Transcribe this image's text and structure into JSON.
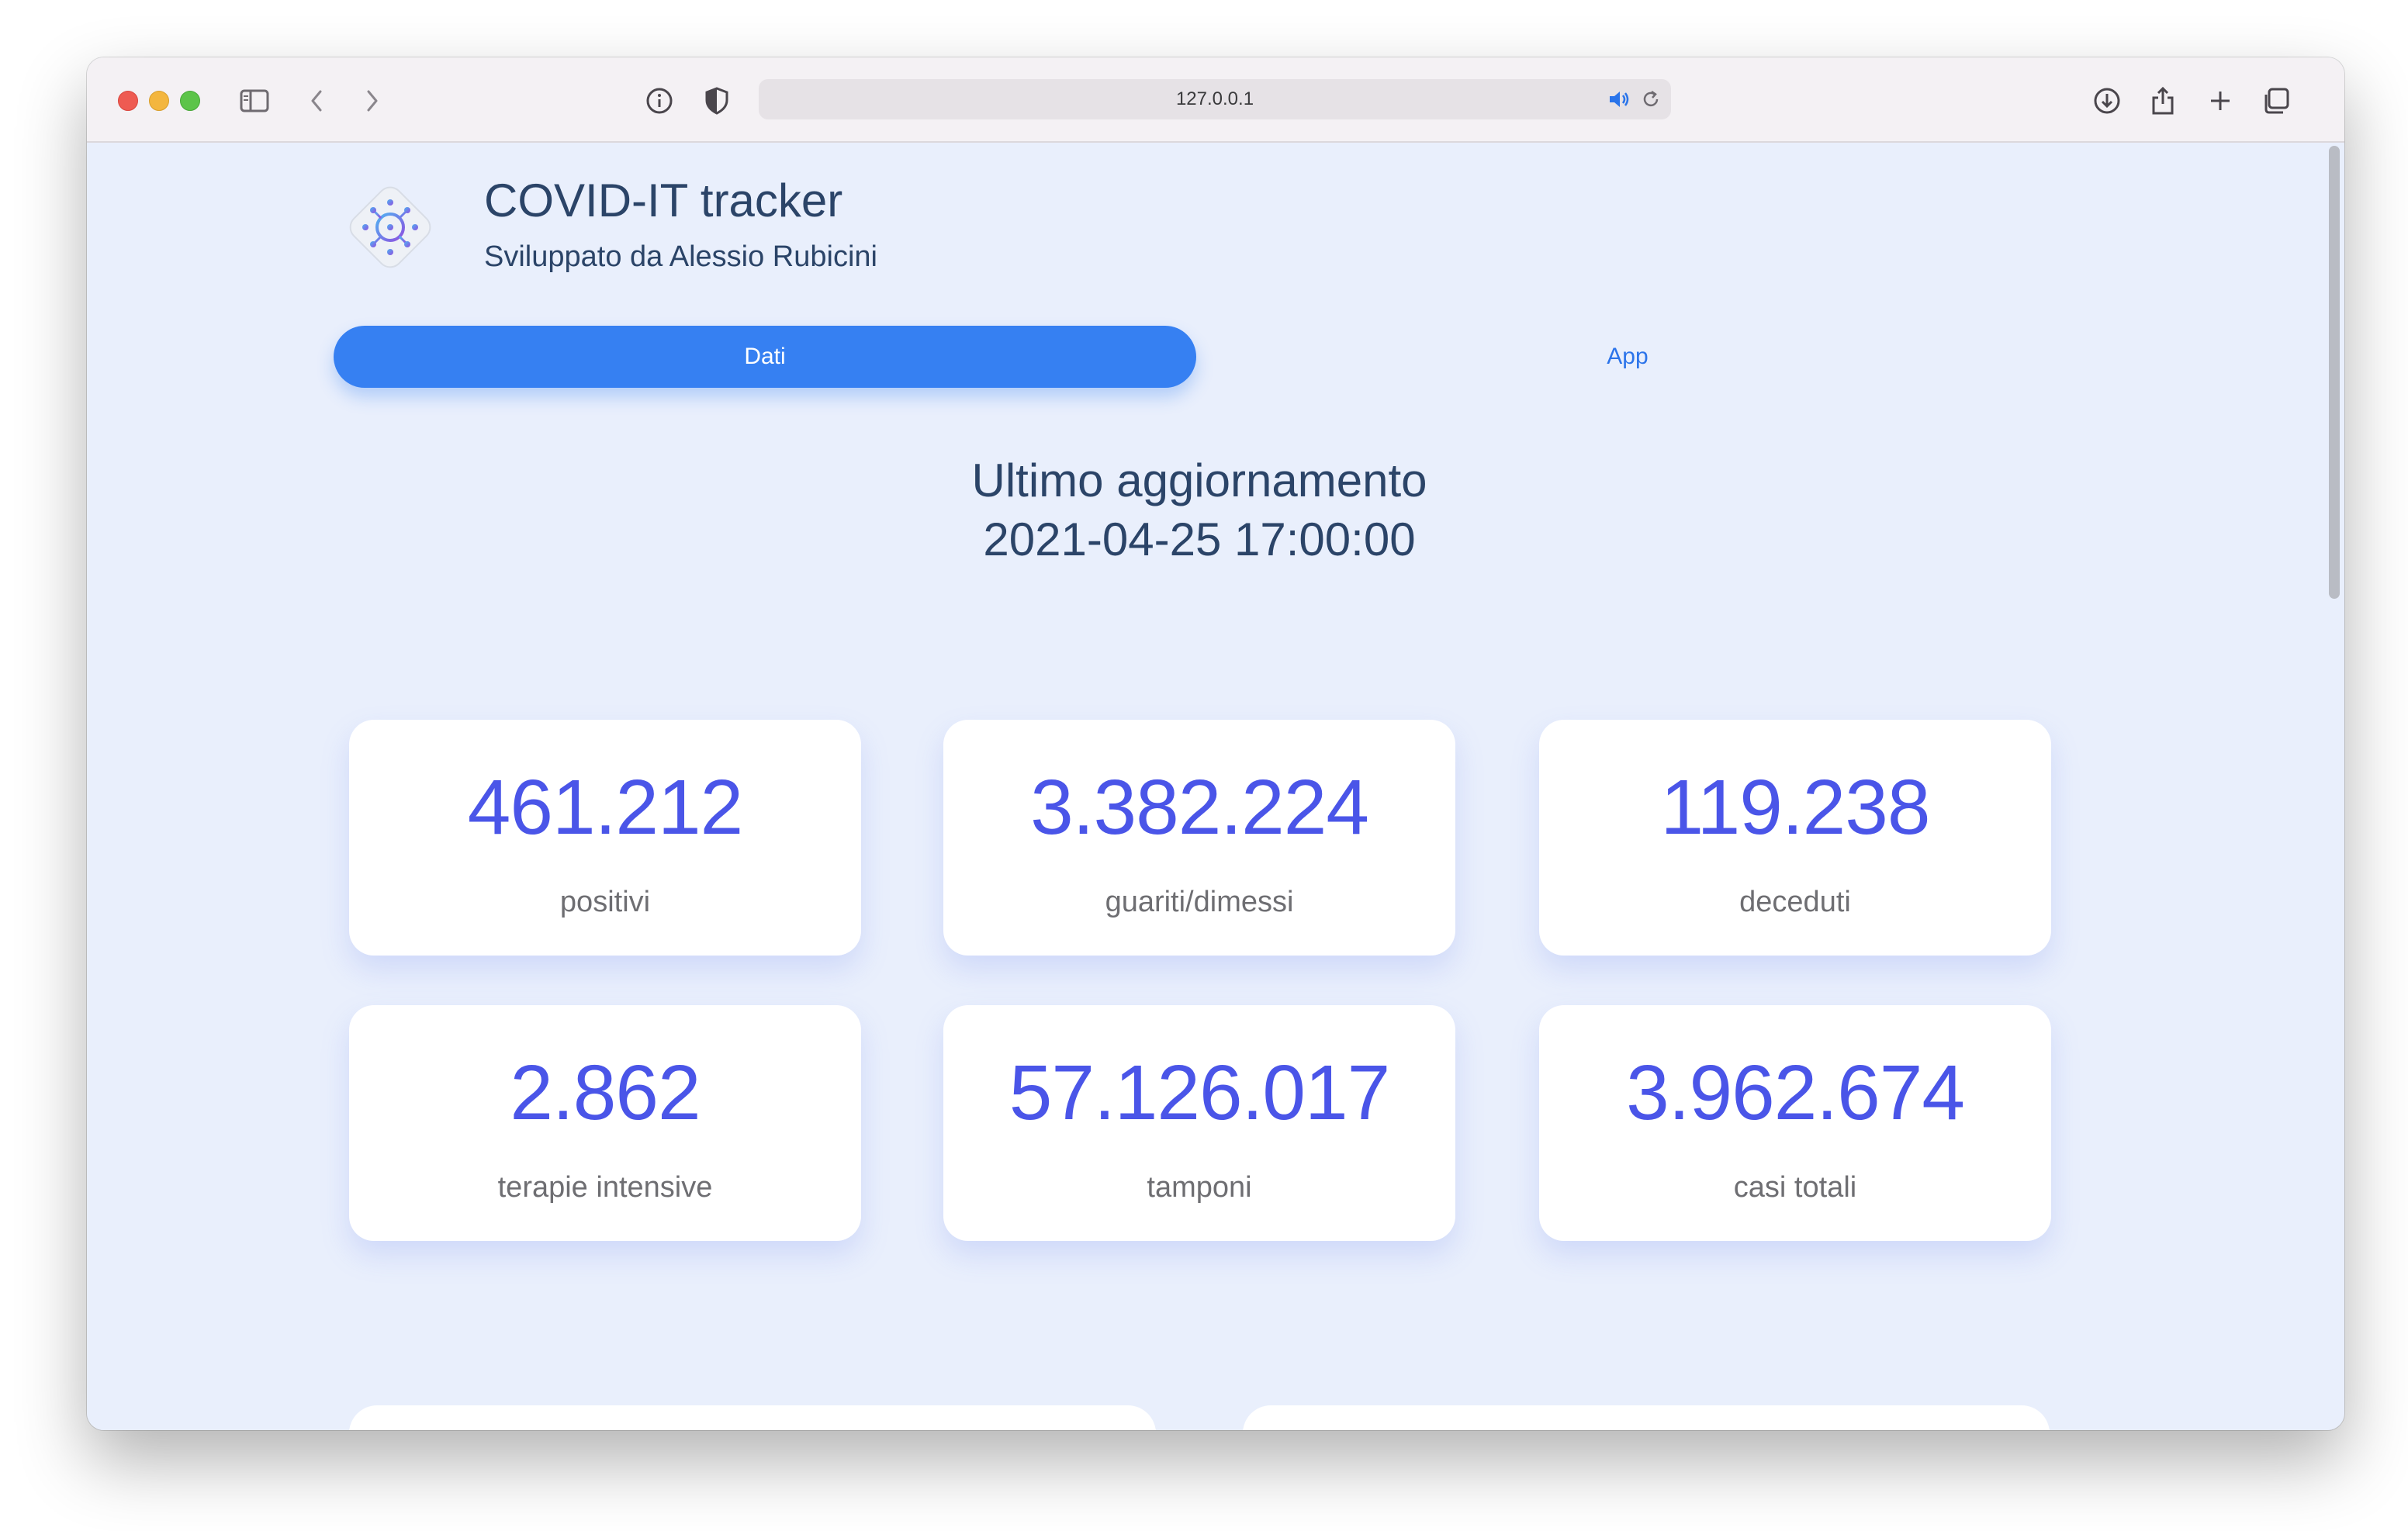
{
  "browser": {
    "url": "127.0.0.1"
  },
  "header": {
    "title": "COVID-IT tracker",
    "subtitle": "Sviluppato da Alessio Rubicini"
  },
  "tabs": [
    {
      "label": "Dati",
      "active": true
    },
    {
      "label": "App",
      "active": false
    }
  ],
  "update": {
    "label": "Ultimo aggiornamento",
    "datetime": "2021-04-25 17:00:00"
  },
  "stats": [
    {
      "value": "461.212",
      "label": "positivi"
    },
    {
      "value": "3.382.224",
      "label": "guariti/dimessi"
    },
    {
      "value": "119.238",
      "label": "deceduti"
    },
    {
      "value": "2.862",
      "label": "terapie intensive"
    },
    {
      "value": "57.126.017",
      "label": "tamponi"
    },
    {
      "value": "3.962.674",
      "label": "casi totali"
    }
  ],
  "colors": {
    "accent": "#3680f2",
    "stat_value": "#4a55e8",
    "background": "#e9effc",
    "heading": "#2b4468"
  }
}
